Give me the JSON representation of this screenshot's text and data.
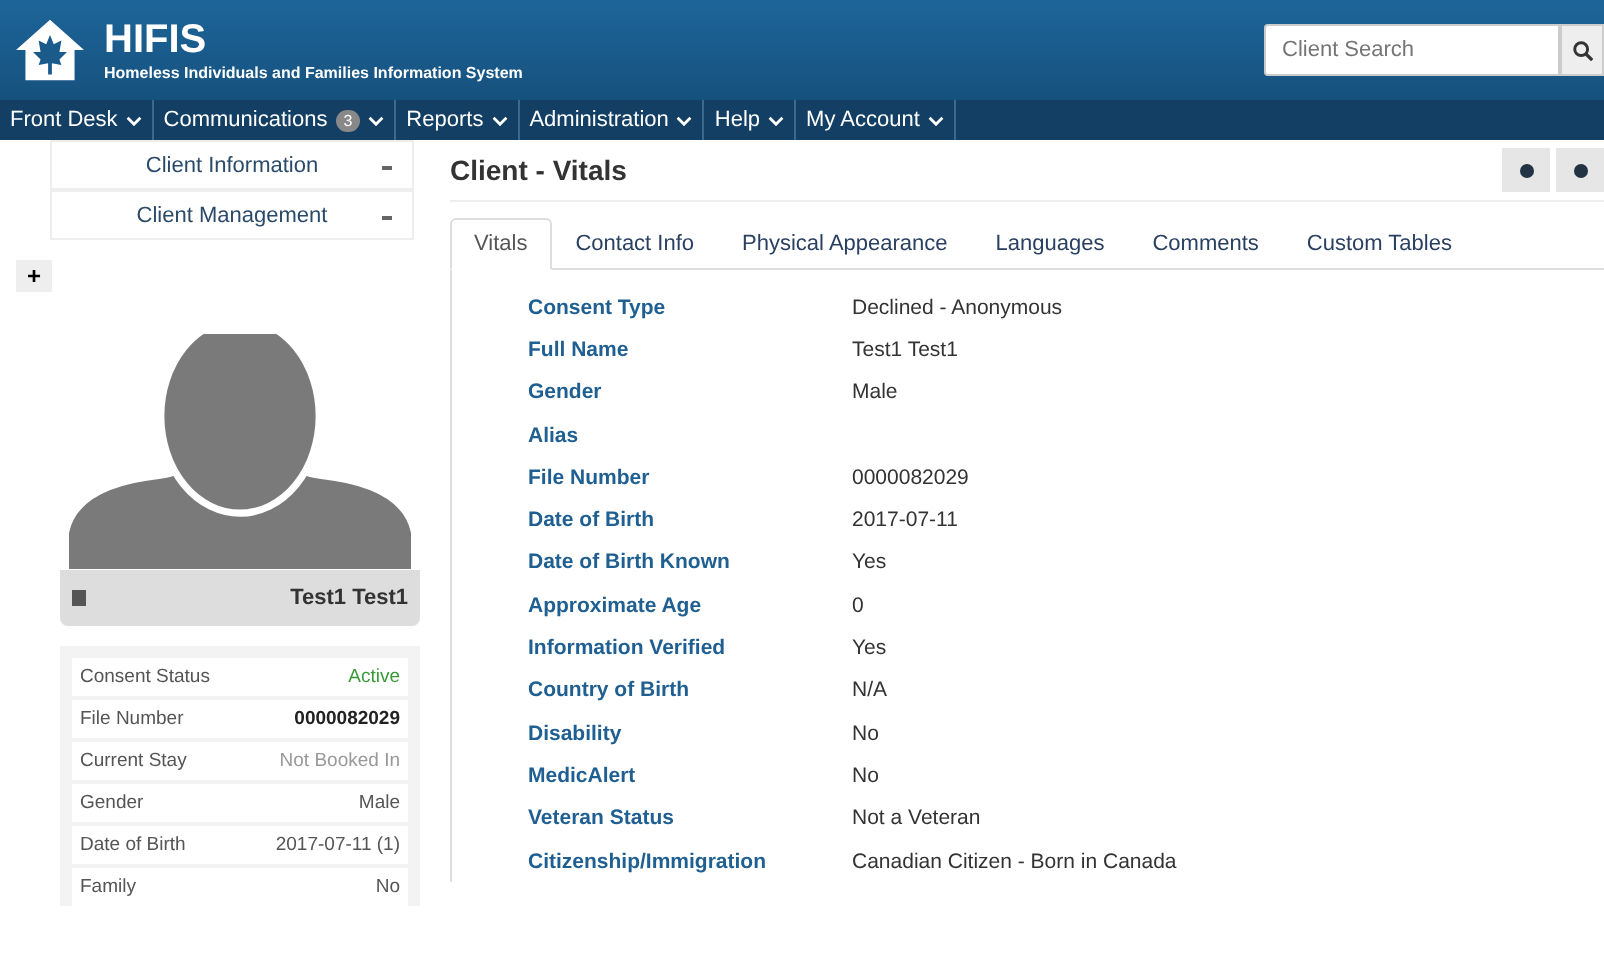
{
  "header": {
    "title": "HIFIS",
    "subtitle": "Homeless Individuals and Families Information System",
    "search": {
      "placeholder": "Client Search"
    }
  },
  "nav": [
    {
      "label": "Front Desk"
    },
    {
      "label": "Communications",
      "badge": "3"
    },
    {
      "label": "Reports"
    },
    {
      "label": "Administration"
    },
    {
      "label": "Help"
    },
    {
      "label": "My Account"
    }
  ],
  "sidebar": {
    "menus": [
      "Client Information",
      "Client Management"
    ],
    "add_button": "+",
    "client_name": "Test1 Test1",
    "summary": [
      {
        "label": "Consent Status",
        "value": "Active",
        "kind": "status"
      },
      {
        "label": "File Number",
        "value": "0000082029",
        "kind": "bold"
      },
      {
        "label": "Current Stay",
        "value": "Not Booked In",
        "kind": "muted"
      },
      {
        "label": "Gender",
        "value": "Male",
        "kind": "plain"
      },
      {
        "label": "Date of Birth",
        "value": "2017-07-11 (1)",
        "kind": "plain"
      },
      {
        "label": "Family",
        "value": "No",
        "kind": "plain"
      }
    ]
  },
  "page": {
    "title": "Client - Vitals",
    "tabs": [
      {
        "label": "Vitals",
        "selected": true
      },
      {
        "label": "Contact Info",
        "selected": false
      },
      {
        "label": "Physical Appearance",
        "selected": false
      },
      {
        "label": "Languages",
        "selected": false
      },
      {
        "label": "Comments",
        "selected": false
      },
      {
        "label": "Custom Tables",
        "selected": false
      }
    ],
    "fields": [
      {
        "label": "Consent Type",
        "value": "Declined - Anonymous"
      },
      {
        "label": "Full Name",
        "value": "Test1 Test1"
      },
      {
        "label": "Gender",
        "value": "Male"
      },
      {
        "label": "Alias"
      },
      {
        "label": "File Number",
        "value": "0000082029"
      },
      {
        "label": "Date of Birth",
        "value": "2017-07-11"
      },
      {
        "label": "Date of Birth Known",
        "value": "Yes"
      },
      {
        "label": "Approximate Age",
        "value": "0"
      },
      {
        "label": "Information Verified",
        "value": "Yes"
      },
      {
        "label": "Country of Birth",
        "value": "N/A"
      },
      {
        "label": "Disability",
        "value": "No"
      },
      {
        "label": "MedicAlert",
        "value": "No"
      },
      {
        "label": "Veteran Status",
        "value": "Not a Veteran"
      },
      {
        "label": "Citizenship/Immigration",
        "value": "Canadian Citizen - Born in Canada"
      }
    ]
  }
}
